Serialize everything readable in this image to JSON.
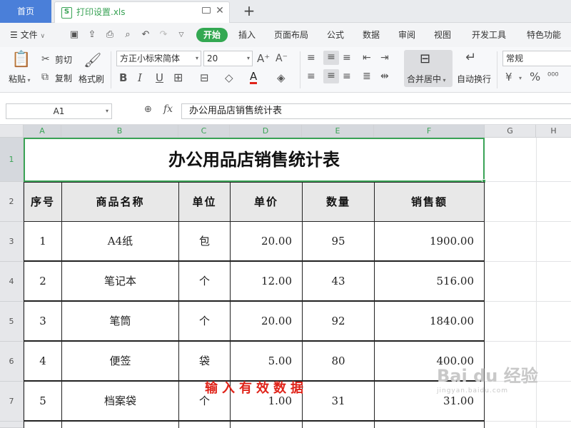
{
  "tabs": {
    "home": "首页",
    "file": "打印设置.xls"
  },
  "menu": {
    "file": "文件",
    "tabs": [
      "开始",
      "插入",
      "页面布局",
      "公式",
      "数据",
      "审阅",
      "视图",
      "开发工具",
      "特色功能"
    ],
    "active_index": 0
  },
  "ribbon": {
    "paste": "粘贴",
    "cut": "剪切",
    "copy": "复制",
    "format_painter": "格式刷",
    "font_name": "方正小标宋简体",
    "font_size": "20",
    "bold": "B",
    "italic": "I",
    "underline": "U",
    "merge_center": "合并居中",
    "wrap_text": "自动换行",
    "number_format": "常规",
    "percent": "%"
  },
  "formula_bar": {
    "name_box": "A1",
    "fx": "fx",
    "content": "办公用品店销售统计表"
  },
  "grid": {
    "columns": [
      "A",
      "B",
      "C",
      "D",
      "E",
      "F",
      "G",
      "H"
    ],
    "rows": [
      "1",
      "2",
      "3",
      "4",
      "5",
      "6",
      "7"
    ],
    "title": "办公用品店销售统计表",
    "headers": [
      "序号",
      "商品名称",
      "单位",
      "单价",
      "数量",
      "销售额"
    ],
    "data": [
      [
        "1",
        "A4纸",
        "包",
        "20.00",
        "95",
        "1900.00"
      ],
      [
        "2",
        "笔记本",
        "个",
        "12.00",
        "43",
        "516.00"
      ],
      [
        "3",
        "笔筒",
        "个",
        "20.00",
        "92",
        "1840.00"
      ],
      [
        "4",
        "便签",
        "袋",
        "5.00",
        "80",
        "400.00"
      ],
      [
        "5",
        "档案袋",
        "个",
        "1.00",
        "31",
        "31.00"
      ]
    ]
  },
  "annotation": "输入有效数据",
  "watermark": {
    "main": "Bai du 经验",
    "sub": "jingyan.baidu.com"
  },
  "colors": {
    "accent_green": "#33a852",
    "home_tab_blue": "#4a7fd9",
    "annotation_red": "#e0241a",
    "header_fill": "#e8e8e8"
  }
}
